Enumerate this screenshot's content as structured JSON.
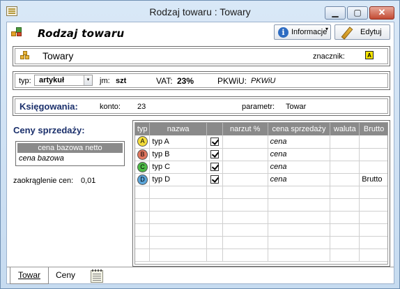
{
  "window": {
    "title": "Rodzaj towaru : Towary",
    "min_glyph": "▁",
    "max_glyph": "▢",
    "close_glyph": "✕"
  },
  "header": {
    "title": "Rodzaj towaru",
    "info_label": "Informacje",
    "info_icon_glyph": "i",
    "caret": "▾",
    "edit_label": "Edytuj"
  },
  "towary": {
    "name": "Towary",
    "znacznik_label": "znacznik:",
    "znacznik_value": "A"
  },
  "details": {
    "typ_label": "typ:",
    "typ_value": "artykuł",
    "typ_arrow": "▾",
    "jm_label": "jm:",
    "jm_value": "szt",
    "vat_label": "VAT:",
    "vat_value": "23%",
    "pkwiu_label": "PKWiU:",
    "pkwiu_value": "PKWiU"
  },
  "ksiegowania": {
    "label": "Księgowania:",
    "konto_label": "konto:",
    "konto_value": "23",
    "parametr_label": "parametr:",
    "parametr_value": "Towar"
  },
  "ceny": {
    "title": "Ceny sprzedaży:",
    "bazowa_header": "cena bazowa netto",
    "bazowa_value": "cena bazowa",
    "zaokr_label": "zaokrąglenie cen:",
    "zaokr_value": "0,01"
  },
  "grid": {
    "columns": [
      "typ",
      "nazwa",
      "",
      "narzut %",
      "cena sprzedaży",
      "waluta",
      "Brutto"
    ],
    "rows": [
      {
        "badge": "A",
        "color": "#f3dc3a",
        "nazwa": "typ A",
        "checked": true,
        "narzut": "",
        "cena": "cena",
        "waluta": "",
        "brutto": ""
      },
      {
        "badge": "B",
        "color": "#e2765f",
        "nazwa": "typ B",
        "checked": true,
        "narzut": "",
        "cena": "cena",
        "waluta": "",
        "brutto": ""
      },
      {
        "badge": "C",
        "color": "#4dbb46",
        "nazwa": "typ C",
        "checked": true,
        "narzut": "",
        "cena": "cena",
        "waluta": "",
        "brutto": ""
      },
      {
        "badge": "D",
        "color": "#5aa4d8",
        "nazwa": "typ D",
        "checked": true,
        "narzut": "",
        "cena": "cena",
        "waluta": "",
        "brutto": "Brutto"
      }
    ],
    "empty_rows": 6
  },
  "tabs": {
    "towar": "Towar",
    "ceny": "Ceny"
  }
}
